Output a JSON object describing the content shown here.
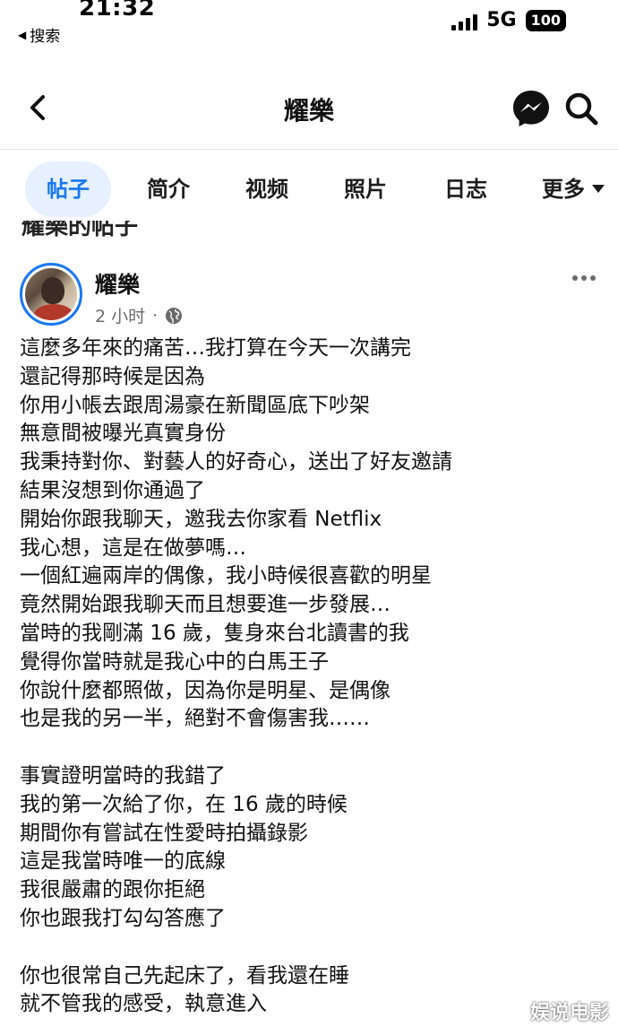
{
  "status_bar": {
    "time": "21:32",
    "back_label": "搜索",
    "network": "5G",
    "battery": "100"
  },
  "header": {
    "title": "耀樂",
    "icons": [
      "chevron-left-icon",
      "messenger-icon",
      "search-icon"
    ]
  },
  "tabs": [
    {
      "label": "帖子",
      "active": true
    },
    {
      "label": "简介",
      "active": false
    },
    {
      "label": "视频",
      "active": false
    },
    {
      "label": "照片",
      "active": false
    },
    {
      "label": "日志",
      "active": false
    },
    {
      "label": "更多",
      "active": false
    }
  ],
  "section_heading": "耀樂的帖子",
  "post": {
    "author": "耀樂",
    "time": "2 小时",
    "separator": "·",
    "privacy_icon": "globe-icon",
    "lines": [
      "這麼多年來的痛苦…我打算在今天一次講完",
      "還記得那時候是因為",
      "你用小帳去跟周湯豪在新聞區底下吵架",
      "無意間被曝光真實身份",
      "我秉持對你、對藝人的好奇心，送出了好友邀請",
      "結果沒想到你通過了",
      "開始你跟我聊天，邀我去你家看 Netflix",
      "我心想，這是在做夢嗎…",
      "一個紅遍兩岸的偶像，我小時候很喜歡的明星",
      "竟然開始跟我聊天而且想要進一步發展…",
      "當時的我剛滿 16 歲，隻身來台北讀書的我",
      "覺得你當時就是我心中的白馬王子",
      "你說什麼都照做，因為你是明星、是偶像",
      "也是我的另一半，絕對不會傷害我……",
      "",
      "事實證明當時的我錯了",
      "我的第一次給了你，在 16 歲的時候",
      "期間你有嘗試在性愛時拍攝錄影",
      "這是我當時唯一的底線",
      "我很嚴肅的跟你拒絕",
      "你也跟我打勾勾答應了",
      "",
      "你也很常自己先起床了，看我還在睡",
      "就不管我的感受，執意進入"
    ]
  },
  "watermark": "娱说电影",
  "colors": {
    "accent": "#1877f2",
    "active_tab_bg": "#e6f0ff",
    "meta_text": "#6b6b6b"
  }
}
